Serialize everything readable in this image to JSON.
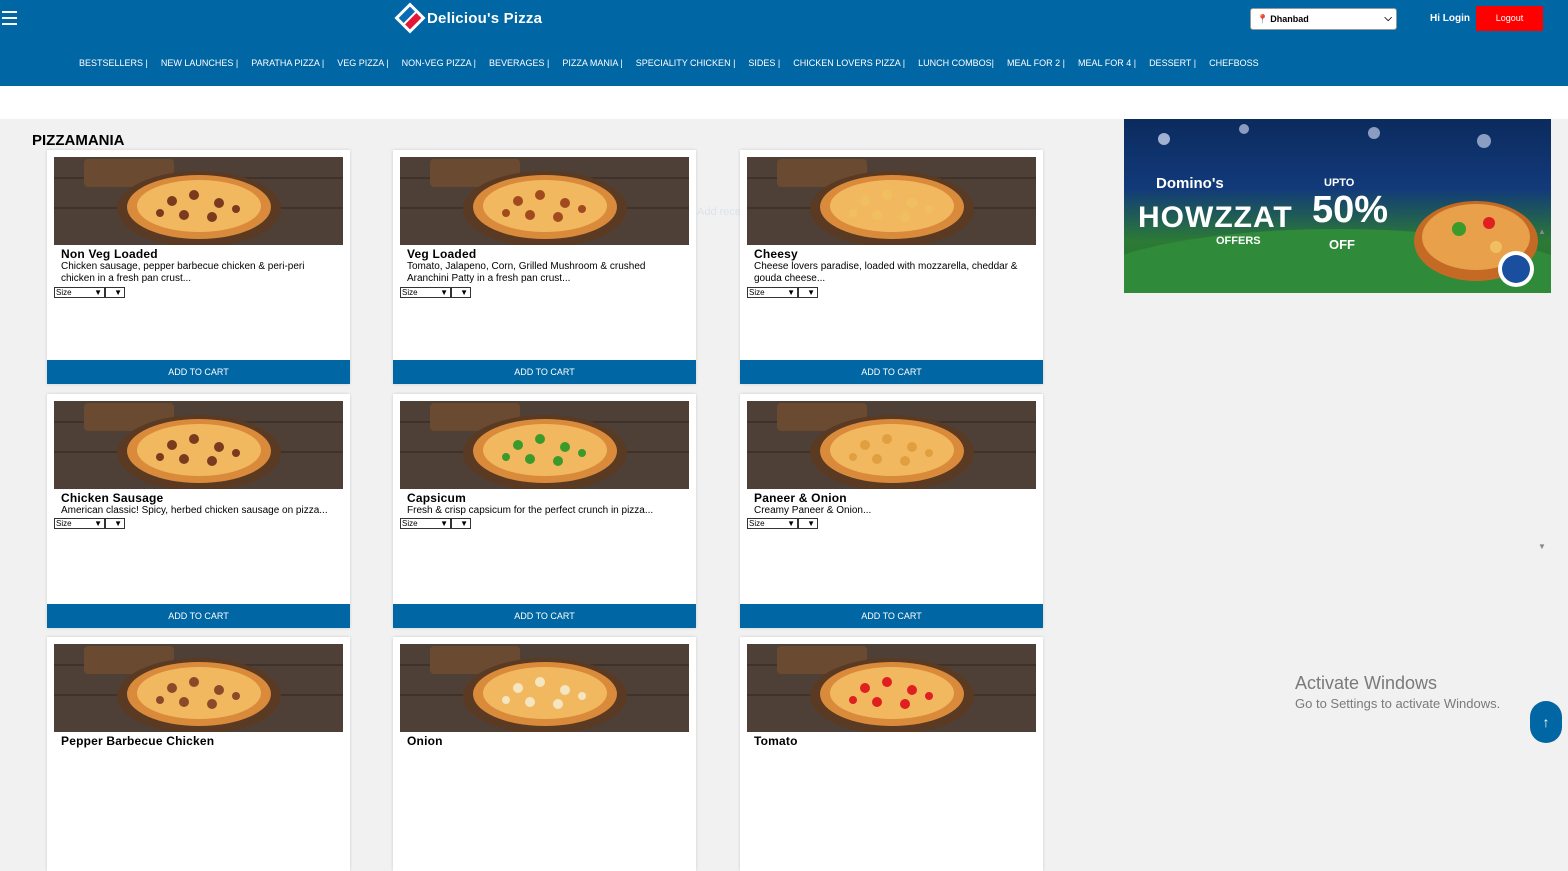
{
  "header": {
    "brand": "Deliciou's Pizza",
    "city": "Dhanbad",
    "greeting": "Hi Login",
    "logout_label": "Logout"
  },
  "nav": [
    "BESTSELLERS |",
    "NEW LAUNCHES |",
    "PARATHA PIZZA |",
    "VEG PIZZA |",
    "NON-VEG PIZZA |",
    "BEVERAGES |",
    "PIZZA MANIA |",
    "SPECIALITY CHICKEN |",
    "SIDES |",
    "CHICKEN LOVERS PIZZA |",
    "LUNCH COMBOS|",
    "MEAL FOR 2 |",
    "MEAL FOR 4 |",
    "DESSERT |",
    "CHEFBOSS"
  ],
  "section_title": "PIZZAMANIA",
  "add_label": "ADD TO CART",
  "size_placeholder": "Size",
  "products": [
    {
      "name": "Non Veg Loaded",
      "desc": "Chicken sausage, pepper barbecue chicken & peri-peri chicken in a fresh pan crust...",
      "topping": "#7a3a1e"
    },
    {
      "name": "Veg Loaded",
      "desc": "Tomato, Jalapeno, Corn, Grilled Mushroom & crushed Aranchini Patty in a fresh pan crust...",
      "topping": "#a04a1e"
    },
    {
      "name": "Cheesy",
      "desc": "Cheese lovers paradise, loaded with mozzarella, cheddar & gouda cheese...",
      "topping": "#f0c060"
    },
    {
      "name": "Chicken Sausage",
      "desc": "American classic! Spicy, herbed chicken sausage on pizza...",
      "topping": "#7a3a1e"
    },
    {
      "name": "Capsicum",
      "desc": "Fresh & crisp capsicum for the perfect crunch in pizza...",
      "topping": "#3a9a2a"
    },
    {
      "name": "Paneer & Onion",
      "desc": "Creamy Paneer & Onion...",
      "topping": "#e0a040"
    },
    {
      "name": "Pepper Barbecue Chicken",
      "desc": "",
      "topping": "#8a4a2a"
    },
    {
      "name": "Onion",
      "desc": "",
      "topping": "#f3e6c0"
    },
    {
      "name": "Tomato",
      "desc": "",
      "topping": "#e02020"
    }
  ],
  "banner": {
    "brand": "Domino's",
    "headline": "HOWZZAT",
    "offers": "OFFERS",
    "upto": "UPTO",
    "percent": "50%",
    "off": "OFF"
  },
  "watermark": {
    "line1": "Activate Windows",
    "line2": "Go to Settings to activate Windows."
  },
  "faint_text": "Add recent..."
}
